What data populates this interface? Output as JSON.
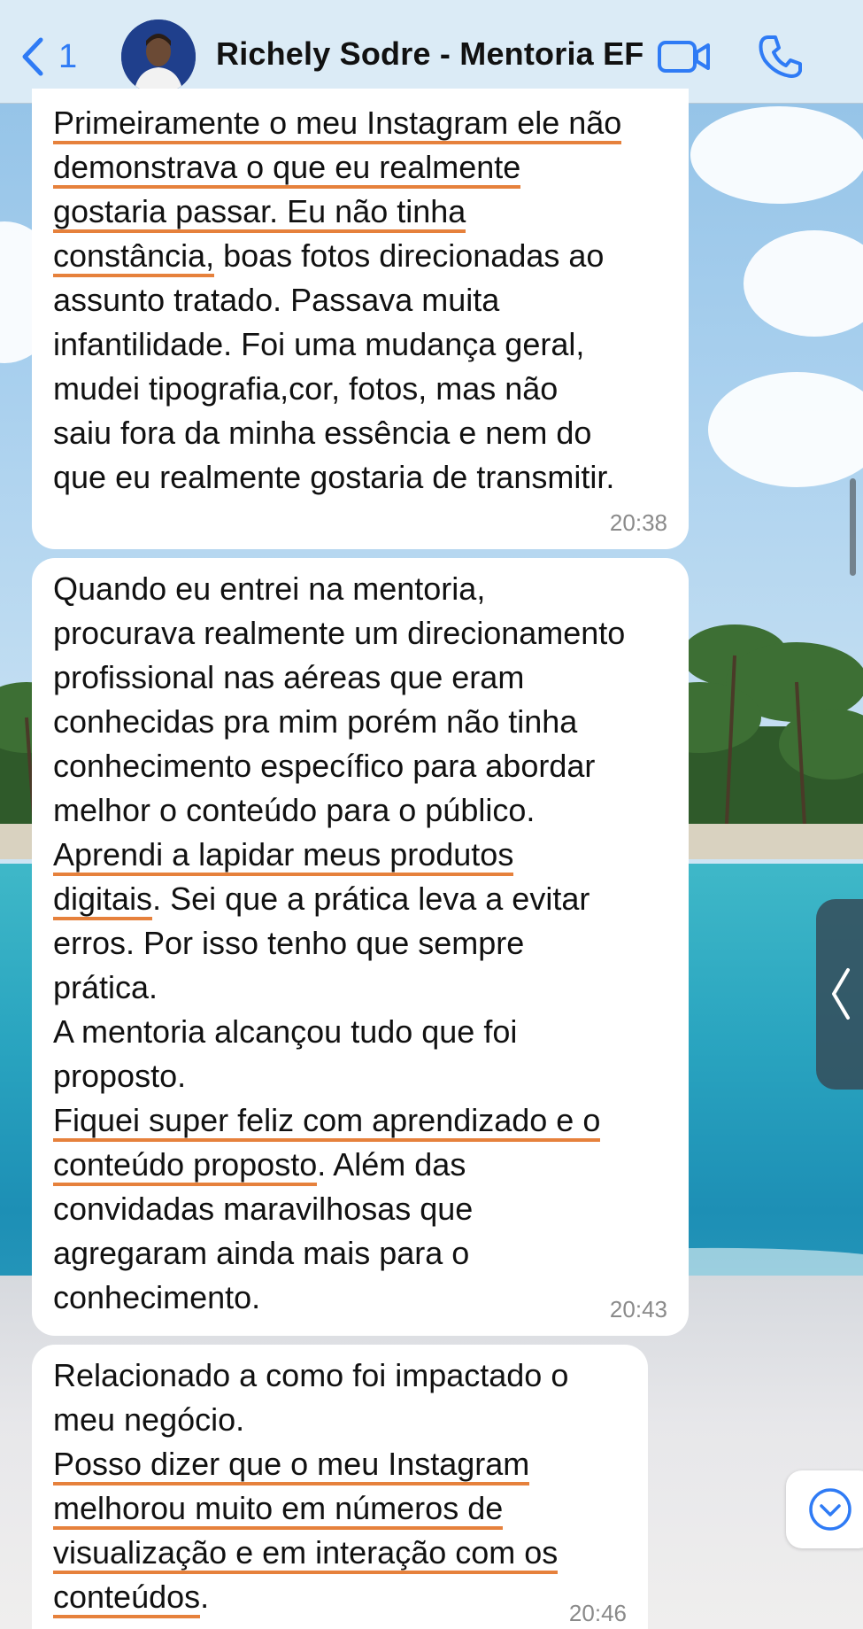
{
  "header": {
    "back_count": "1",
    "contact_name": "Richely Sodre - Mentoria EF"
  },
  "colors": {
    "accent": "#2f7bf5",
    "underline": "#e6813c",
    "bubble": "#ffffff",
    "timestamp": "#8a8a8a"
  },
  "icons": [
    "chevron-left-icon",
    "video-camera-icon",
    "phone-icon",
    "chevron-left-handle-icon",
    "chevron-down-circle-icon"
  ],
  "messages": [
    {
      "time": "20:38",
      "lines": [
        [
          {
            "t": "Primeiramente o meu Instagram ele não",
            "u": true
          }
        ],
        [
          {
            "t": "demonstrava o que eu realmente",
            "u": true
          }
        ],
        [
          {
            "t": "gostaria passar. Eu não tinha",
            "u": true
          }
        ],
        [
          {
            "t": "constância,",
            "u": true
          },
          {
            "t": " boas fotos direcionadas ao",
            "u": false
          }
        ],
        [
          {
            "t": "assunto tratado. Passava muita",
            "u": false
          }
        ],
        [
          {
            "t": "infantilidade. Foi uma mudança geral,",
            "u": false
          }
        ],
        [
          {
            "t": "mudei tipografia,cor, fotos, mas não",
            "u": false
          }
        ],
        [
          {
            "t": "saiu fora da minha essência e nem do",
            "u": false
          }
        ],
        [
          {
            "t": "que eu realmente gostaria de transmitir.",
            "u": false
          }
        ]
      ]
    },
    {
      "time": "20:43",
      "lines": [
        [
          {
            "t": "Quando eu entrei na mentoria,",
            "u": false
          }
        ],
        [
          {
            "t": "procurava realmente um direcionamento",
            "u": false
          }
        ],
        [
          {
            "t": "profissional nas aéreas que eram",
            "u": false
          }
        ],
        [
          {
            "t": "conhecidas pra mim porém não tinha",
            "u": false
          }
        ],
        [
          {
            "t": "conhecimento específico para abordar",
            "u": false
          }
        ],
        [
          {
            "t": "melhor o conteúdo para o público.",
            "u": false
          }
        ],
        [
          {
            "t": "Aprendi a lapidar meus produtos",
            "u": true
          }
        ],
        [
          {
            "t": "digitais",
            "u": true
          },
          {
            "t": ". Sei que a prática leva a evitar",
            "u": false
          }
        ],
        [
          {
            "t": "erros. Por isso tenho que sempre",
            "u": false
          }
        ],
        [
          {
            "t": "prática.",
            "u": false
          }
        ],
        [
          {
            "t": "A mentoria alcançou tudo que foi",
            "u": false
          }
        ],
        [
          {
            "t": "proposto.",
            "u": false
          }
        ],
        [
          {
            "t": "Fiquei super feliz com aprendizado e o",
            "u": true
          }
        ],
        [
          {
            "t": "conteúdo proposto",
            "u": true
          },
          {
            "t": ". Além das",
            "u": false
          }
        ],
        [
          {
            "t": "convidadas maravilhosas que",
            "u": false
          }
        ],
        [
          {
            "t": "agregaram ainda mais para o",
            "u": false
          }
        ],
        [
          {
            "t": "conhecimento.",
            "u": false
          }
        ]
      ]
    },
    {
      "time": "20:46",
      "lines": [
        [
          {
            "t": "Relacionado a como foi impactado o",
            "u": false
          }
        ],
        [
          {
            "t": "meu negócio.",
            "u": false
          }
        ],
        [
          {
            "t": "Posso dizer que o meu Instagram",
            "u": true
          }
        ],
        [
          {
            "t": "melhorou muito em números de",
            "u": true
          }
        ],
        [
          {
            "t": "visualização e em interação com os",
            "u": true
          }
        ],
        [
          {
            "t": "conteúdos",
            "u": true
          },
          {
            "t": ".",
            "u": false
          }
        ]
      ]
    }
  ]
}
